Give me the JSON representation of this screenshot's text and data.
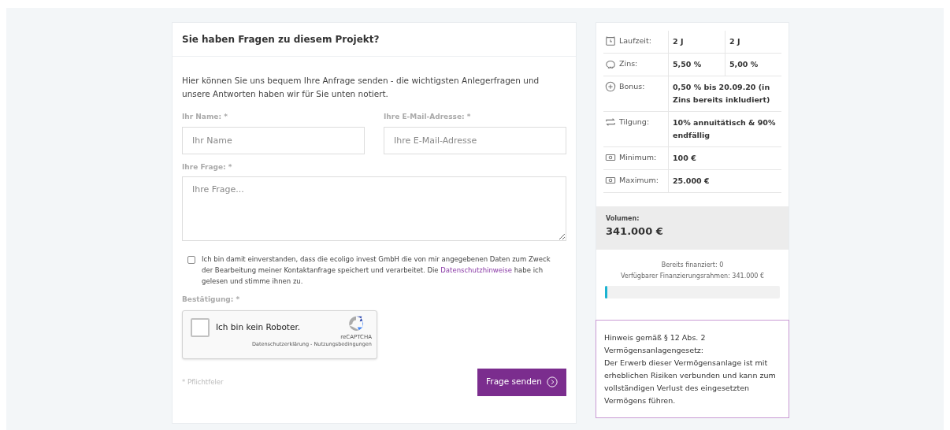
{
  "contact": {
    "title": "Sie haben Fragen zu diesem Projekt?",
    "intro": "Hier können Sie uns bequem Ihre Anfrage senden - die wichtigsten Anlegerfragen und unsere Antworten haben wir für Sie unten notiert.",
    "name_field": {
      "label": "Ihr Name: *",
      "placeholder": "Ihr Name"
    },
    "email_field": {
      "label": "Ihre E-Mail-Adresse: *",
      "placeholder": "Ihre E-Mail-Adresse"
    },
    "question_field": {
      "label": "Ihre Frage: *",
      "placeholder": "Ihre Frage..."
    },
    "consent": {
      "checked": false,
      "text_before": "Ich bin damit einverstanden, dass die ecoligo invest GmbH die von mir angegebenen Daten zum Zweck der Bearbeitung meiner Kontaktanfrage speichert und verarbeitet. Die ",
      "link": "Datenschutzhinweise",
      "text_after": " habe ich gelesen und stimme ihnen zu."
    },
    "captcha_label": "Bestätigung: *",
    "captcha": {
      "checked": false,
      "text": "Ich bin kein Roboter.",
      "brand": "reCAPTCHA",
      "links": "Datenschutzerklärung - Nutzungsbedingungen"
    },
    "required_note": "* Pflichtfeler",
    "submit": "Frage senden"
  },
  "terms": [
    {
      "kind": "clock",
      "label": "Laufzeit:",
      "values": [
        "2 J",
        "2 J"
      ]
    },
    {
      "kind": "piggy",
      "label": "Zins:",
      "values": [
        "5,50 %",
        "5,00 %"
      ]
    },
    {
      "kind": "plus",
      "label": "Bonus:",
      "values": [
        "0,50 % bis 20.09.20 (in Zins bereits inkludiert)"
      ]
    },
    {
      "kind": "repeat",
      "label": "Tilgung:",
      "values": [
        "10% annuitätisch & 90% endfällig"
      ]
    },
    {
      "kind": "money",
      "label": "Minimum:",
      "values": [
        "100 €"
      ]
    },
    {
      "kind": "money",
      "label": "Maximum:",
      "values": [
        "25.000 €"
      ]
    }
  ],
  "volume": {
    "label": "Volumen:",
    "value": "341.000 €"
  },
  "funding": {
    "financed": "Bereits finanziert: 0",
    "available": "Verfügbarer Finanzierungsrahmen: 341.000 €",
    "level": 0.01
  },
  "notice": {
    "heading": "Hinweis gemäß § 12 Abs. 2 Vermögensanlagengesetz:",
    "text": "Der Erwerb dieser Vermögensanlage ist mit erheblichen Risiken verbunden und kann zum vollständigen Verlust des eingesetzten Vermögens führen."
  }
}
